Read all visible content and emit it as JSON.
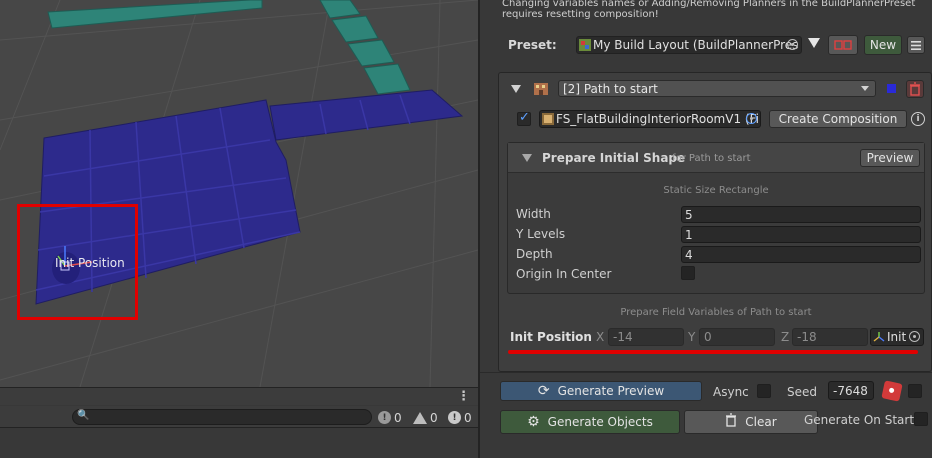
{
  "scene": {
    "init_label": "Init Position"
  },
  "console": {
    "search_placeholder": "",
    "log_count": "0",
    "warning_count": "0",
    "error_count": "0"
  },
  "inspector": {
    "warning_text": "Changing variables names or Adding/Removing Planners in the BuildPlannerPreset requires resetting composition!",
    "preset": {
      "label": "Preset:",
      "value": "My Build Layout (BuildPlannerPres",
      "new_label": "New"
    },
    "planner": {
      "name": "[2] Path to start",
      "file": "FS_FlatBuildingInteriorRoomV1 (Fi",
      "create_composition": "Create Composition",
      "color": "#2a2ad8"
    },
    "prepare_shape": {
      "title": "Prepare Initial Shape",
      "subtitle": "for Path to start",
      "preview_label": "Preview",
      "caption": "Static Size Rectangle",
      "fields": [
        {
          "label": "Width",
          "value": "5"
        },
        {
          "label": "Y Levels",
          "value": "1"
        },
        {
          "label": "Depth",
          "value": "4"
        }
      ],
      "origin_label": "Origin In Center"
    },
    "field_variables_caption": "Prepare Field Variables of Path to start",
    "init_position": {
      "label": "Init Position",
      "x_label": "X",
      "x_value": "-14",
      "y_label": "Y",
      "y_value": "0",
      "z_label": "Z",
      "z_value": "-18",
      "object": "Init"
    },
    "generate": {
      "preview_label": "Generate Preview",
      "async_label": "Async",
      "seed_label": "Seed",
      "seed_value": "-7648",
      "objects_label": "Generate Objects",
      "clear_label": "Clear",
      "on_start_label": "Generate On Start"
    }
  },
  "colors": {
    "grid_blue": "#2d2a8c",
    "teal": "#2e8478",
    "accent_red": "#e00000"
  }
}
